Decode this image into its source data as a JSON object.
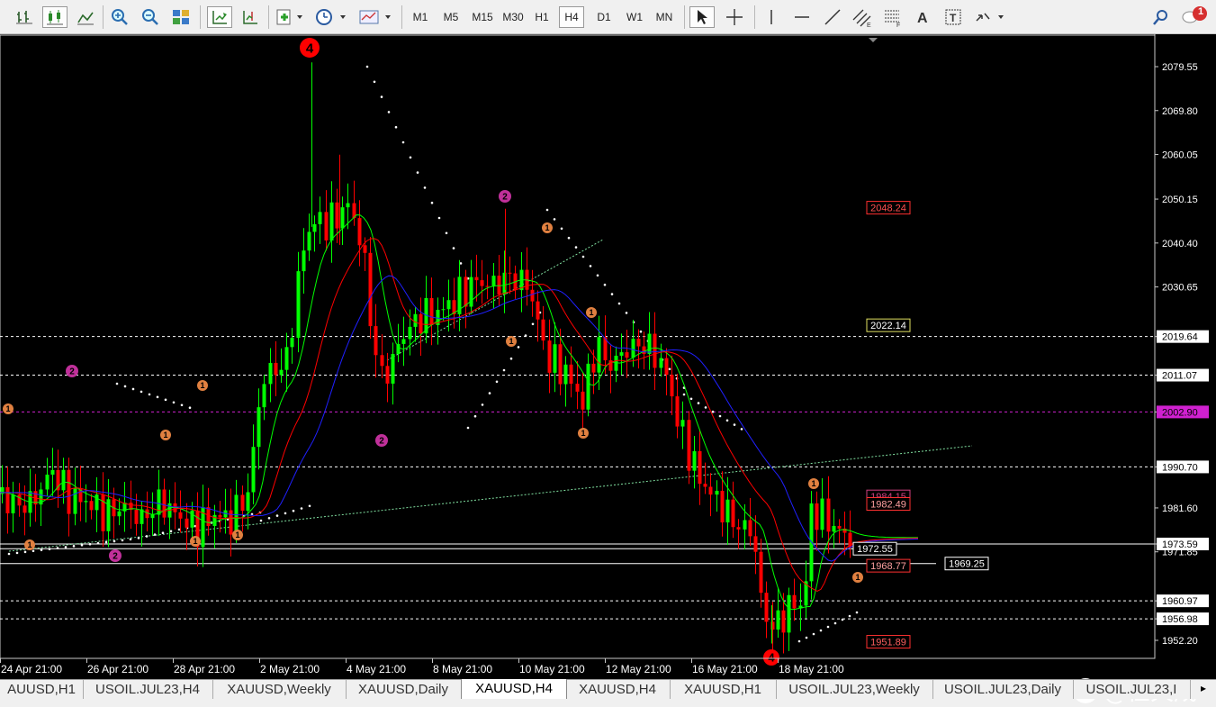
{
  "toolbar": {
    "timeframes": [
      "M1",
      "M5",
      "M15",
      "M30",
      "H1",
      "H4",
      "D1",
      "W1",
      "MN"
    ],
    "active_timeframe": "H4",
    "notification_count": "1",
    "tools": [
      "bar-chart-icon",
      "candlestick-icon",
      "line-chart-icon",
      "zoom-in-icon",
      "zoom-out-icon",
      "tile-windows-icon",
      "autoscroll-icon",
      "chart-shift-icon",
      "new-order-icon",
      "clock-icon",
      "templates-icon",
      "cursor-icon",
      "crosshair-icon",
      "vertical-line-icon",
      "horizontal-line-icon",
      "trendline-icon",
      "channel-icon",
      "fibonacci-icon",
      "text-icon",
      "text-label-icon",
      "arrows-icon",
      "search-icon"
    ]
  },
  "chart": {
    "y_ticks": [
      "2079.55",
      "2069.80",
      "2060.05",
      "2050.15",
      "2040.40",
      "2030.65",
      "2019.64",
      "2011.07",
      "2002.90",
      "1990.70",
      "1981.60",
      "1973.59",
      "1971.85",
      "1960.97",
      "1956.98",
      "1952.20"
    ],
    "x_ticks": [
      "24 Apr 21:00",
      "26 Apr 21:00",
      "28 Apr 21:00",
      "2 May 21:00",
      "4 May 21:00",
      "8 May 21:00",
      "10 May 21:00",
      "12 May 21:00",
      "16 May 21:00",
      "18 May 21:00"
    ],
    "price_labels": {
      "p2048": "2048.24",
      "p2022": "2022.14",
      "p1984": "1984.15",
      "p1982": "1982.49",
      "p1972": "1972.55",
      "p1968": "1968.77",
      "p1969": "1969.25",
      "p1951": "1951.89"
    },
    "wave_labels": {
      "w4": "4",
      "w2": "2",
      "w1": "1"
    },
    "colors": {
      "bull": "#00ff00",
      "bear": "#ff0000",
      "ma_fast": "#00ff00",
      "ma_mid": "#ff0000",
      "ma_slow": "#2020ff",
      "wave_orange": "#e08040",
      "wave_magenta": "#c0309a",
      "wave_red": "#ff0000"
    }
  },
  "tabs": [
    "AUUSD,H1",
    "USOIL.JUL23,H4",
    "XAUUSD,Weekly",
    "XAUUSD,Daily",
    "XAUUSD,H4",
    "XAUUSD,H4",
    "XAUUSD,H1",
    "USOIL.JUL23,Weekly",
    "USOIL.JUL23,Daily",
    "USOIL.JUL23,I"
  ],
  "active_tab_index": 4,
  "watermark": {
    "logo_letter": "f",
    "text": "@任天成"
  }
}
